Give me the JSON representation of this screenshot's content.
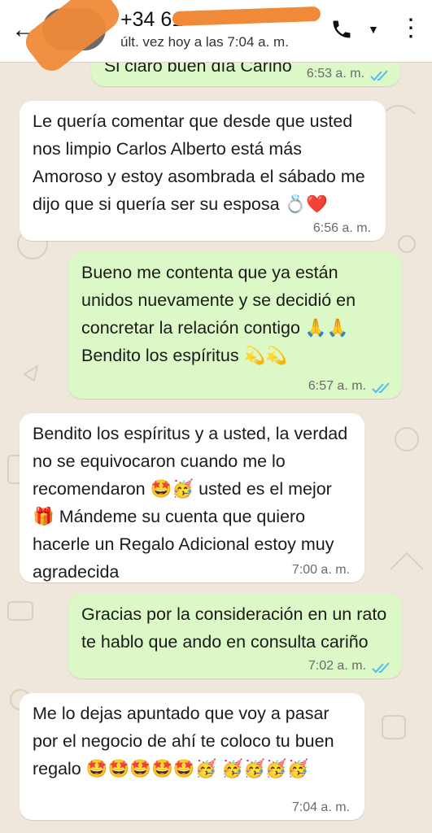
{
  "header": {
    "contact": "+34 61",
    "last_seen": "últ. vez hoy a las 7:04 a. m.",
    "icons": [
      "back-arrow-icon",
      "phone-icon",
      "dropdown-caret-icon",
      "more-vertical-icon"
    ]
  },
  "messages": [
    {
      "dir": "out",
      "text": "Si claro buen día Cariño",
      "time": "6:53 a. m.",
      "status": "read"
    },
    {
      "dir": "in",
      "text": "Le quería comentar que desde que usted nos limpio Carlos Alberto está más Amoroso y estoy asombrada el sábado me dijo que si quería ser su esposa 💍❤️",
      "time": "6:56 a. m."
    },
    {
      "dir": "out",
      "text": "Bueno me contenta que ya están unidos nuevamente y se decidió en concretar la relación contigo 🙏🙏 Bendito los espíritus 💫💫",
      "time": "6:57 a. m.",
      "status": "read"
    },
    {
      "dir": "in",
      "text": "Bendito los espíritus y a usted, la verdad no se equivocaron cuando me lo recomendaron 🤩🥳 usted es el mejor 🎁 Mándeme su cuenta que quiero hacerle un Regalo Adicional estoy muy agradecida",
      "time": "7:00 a. m."
    },
    {
      "dir": "out",
      "text": "Gracias por la consideración en un rato te hablo que ando en consulta cariño",
      "time": "7:02 a. m.",
      "status": "read"
    },
    {
      "dir": "in",
      "text": "Me lo dejas apuntado que voy a pasar por el negocio de ahí te coloco tu buen regalo 🤩🤩🤩🤩🤩🥳 🥳🥳🥳🥳",
      "time": "7:04 a. m."
    }
  ],
  "colors": {
    "incoming": "#ffffff",
    "outgoing": "#dcf8c6",
    "read_ticks": "#53bdeb",
    "redaction": "#f08a38"
  }
}
